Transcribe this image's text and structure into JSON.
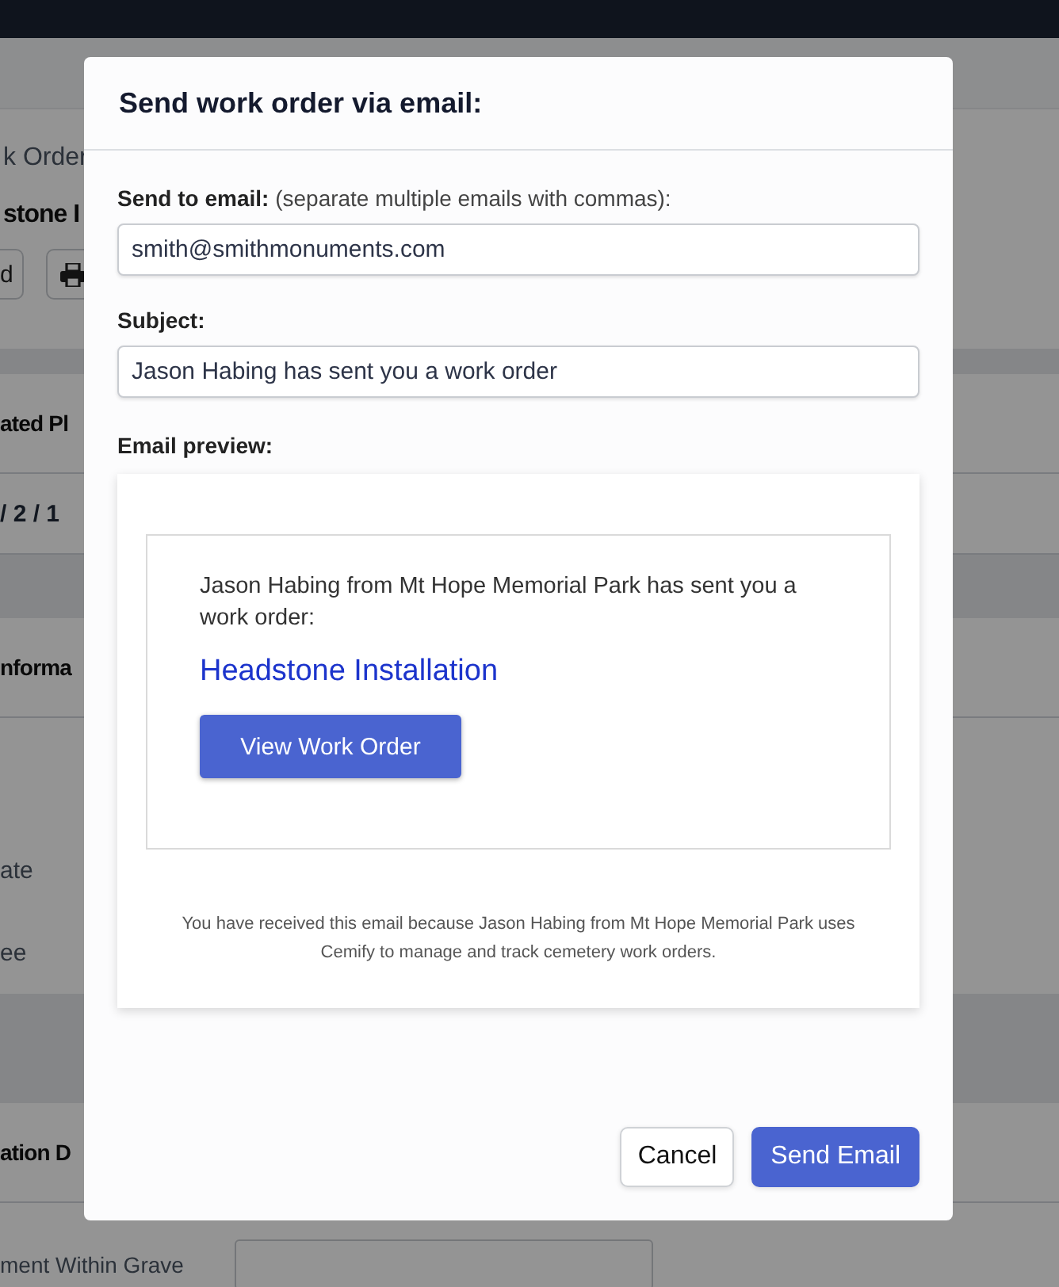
{
  "background_page": {
    "breadcrumb": "k Order",
    "title": "stone I",
    "toolbar_buttons": [
      {
        "kind": "text",
        "label": "d"
      },
      {
        "kind": "print"
      }
    ],
    "sections": [
      {
        "heading": "ated Pl",
        "rows": [
          {
            "kind": "value",
            "text": "/ 2 / 1"
          }
        ]
      },
      {
        "heading": "nforma",
        "rows": [
          {
            "kind": "label",
            "text": "ate"
          },
          {
            "kind": "label",
            "text": "ee"
          }
        ]
      },
      {
        "heading": "ation D",
        "rows": [
          {
            "kind": "field",
            "text": "ment Within Grave"
          },
          {
            "kind": "field"
          }
        ]
      }
    ]
  },
  "modal": {
    "title": "Send work order via email:",
    "fields": [
      {
        "label": "Send to email:",
        "hint": "(separate multiple emails with commas):",
        "value": "smith@smithmonuments.com"
      },
      {
        "label": "Subject:",
        "value": "Jason Habing has sent you a work order"
      }
    ],
    "preview": {
      "label": "Email preview:",
      "message": "Jason Habing from Mt Hope Memorial Park has sent you a work order:",
      "link": "Headstone Installation",
      "button": "View Work Order",
      "footer": "You have received this email because Jason Habing from Mt Hope Memorial Park uses Cemify to manage and track cemetery work orders."
    },
    "buttons": [
      {
        "label": "Cancel",
        "primary": false
      },
      {
        "label": "Send Email",
        "primary": true
      }
    ]
  }
}
